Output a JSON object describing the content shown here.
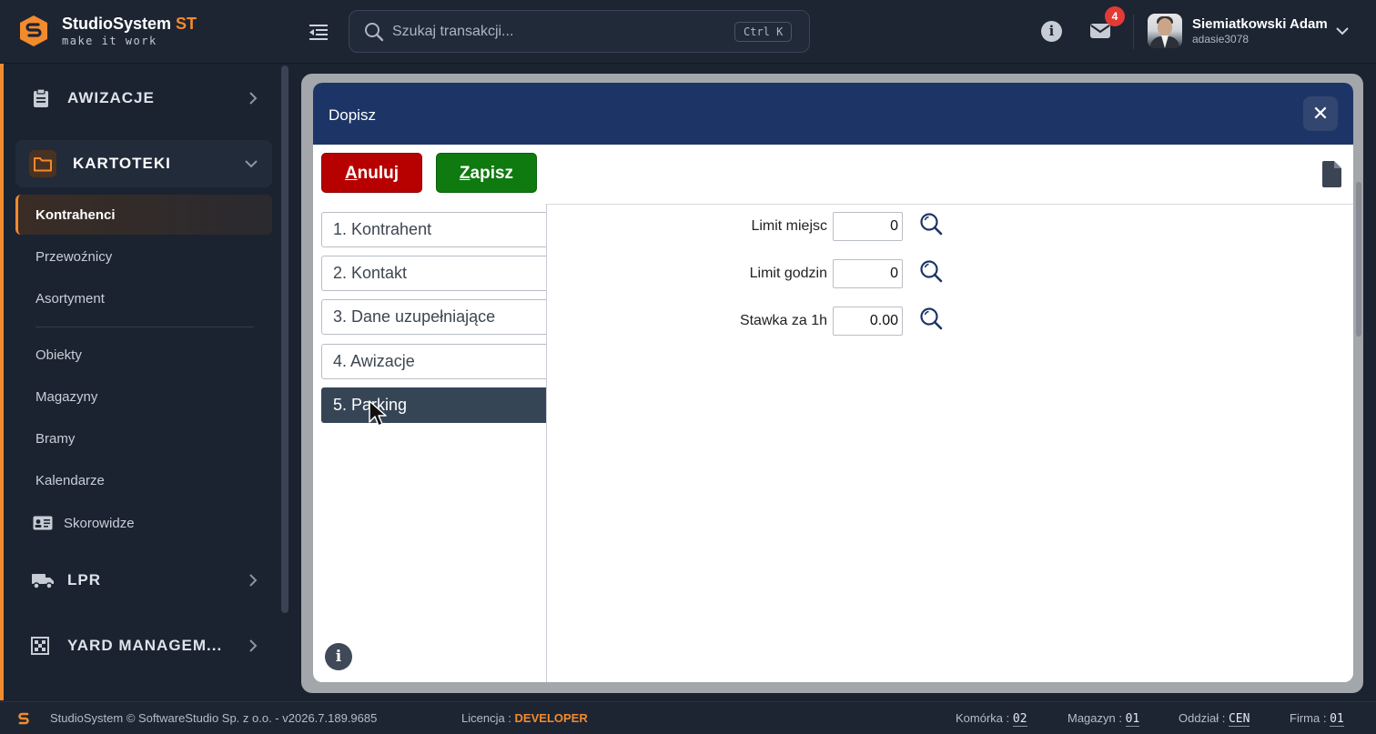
{
  "brand": {
    "name": "StudioSystem",
    "accent": "ST",
    "tagline": "make it work"
  },
  "search": {
    "placeholder": "Szukaj transakcji...",
    "shortcut": "Ctrl K"
  },
  "notifications": {
    "count": "4"
  },
  "user": {
    "name": "Siemiatkowski Adam",
    "login": "adasie3078"
  },
  "sidebar": {
    "groups": [
      {
        "label": "AWIZACJE",
        "icon": "clipboard-icon"
      },
      {
        "label": "KARTOTEKI",
        "icon": "folder-icon"
      },
      {
        "label": "LPR",
        "icon": "truck-icon"
      },
      {
        "label": "YARD MANAGEM...",
        "icon": "grid-icon"
      }
    ],
    "items": [
      {
        "label": "Kontrahenci"
      },
      {
        "label": "Przewoźnicy"
      },
      {
        "label": "Asortyment"
      },
      {
        "label": "Obiekty"
      },
      {
        "label": "Magazyny"
      },
      {
        "label": "Bramy"
      },
      {
        "label": "Kalendarze"
      },
      {
        "label": "Skorowidze",
        "icon": "id-card-icon"
      }
    ]
  },
  "modal": {
    "title": "Dopisz",
    "cancel_rest": "nuluj",
    "cancel_key": "A",
    "save_rest": "apisz",
    "save_key": "Z",
    "tabs": [
      {
        "label": "1. Kontrahent"
      },
      {
        "label": "2. Kontakt"
      },
      {
        "label": "3. Dane uzupełniające"
      },
      {
        "label": "4. Awizacje"
      },
      {
        "label": "5. Parking"
      }
    ],
    "fields": [
      {
        "label": "Limit miejsc",
        "value": "0"
      },
      {
        "label": "Limit godzin",
        "value": "0"
      },
      {
        "label": "Stawka za 1h",
        "value": "0.00"
      }
    ]
  },
  "footer": {
    "copyright": "StudioSystem © SoftwareStudio Sp. z o.o. - v2026.7.189.9685",
    "license_label": "Licencja :",
    "license_value": "DEVELOPER",
    "komorka_label": "Komórka :",
    "komorka_value": "02",
    "magazyn_label": "Magazyn :",
    "magazyn_value": "01",
    "oddzial_label": "Oddział :",
    "oddzial_value": "CEN",
    "firma_label": "Firma :",
    "firma_value": "01"
  },
  "colors": {
    "accent": "#f28a2e",
    "modal_header": "#1d3566",
    "cancel": "#b70000",
    "save": "#0f7a0f",
    "active_tab": "#364556"
  }
}
